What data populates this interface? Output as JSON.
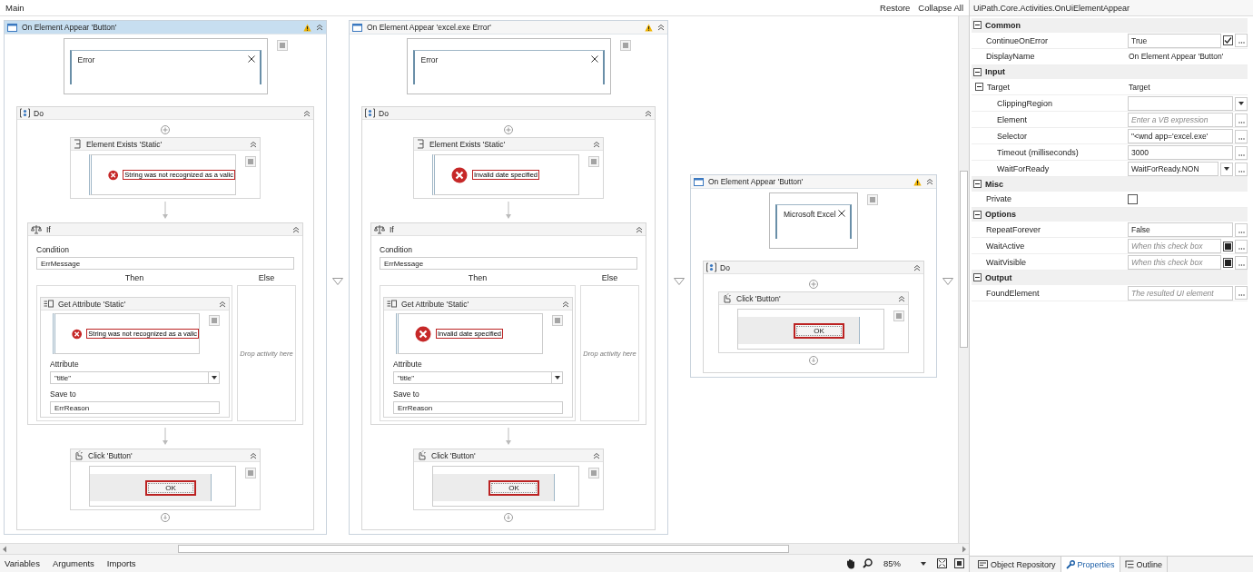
{
  "header": {
    "title": "Main",
    "actions": [
      "Restore",
      "Collapse All"
    ]
  },
  "activities": [
    {
      "title": "On Element Appear 'Button'",
      "selected": true,
      "warning": true,
      "preview": {
        "title": "Error"
      },
      "sequence": {
        "title": "Do",
        "items": [
          {
            "kind": "element_exists",
            "title": "Element Exists 'Static'",
            "preview_text": "String was not recognized as a valic"
          },
          {
            "kind": "if",
            "title": "If",
            "condition_label": "Condition",
            "condition": "ErrMessage",
            "then_label": "Then",
            "else_label": "Else",
            "else_placeholder": "Drop activity here",
            "then": {
              "title": "Get Attribute 'Static'",
              "preview_text": "String was not recognized as a valic",
              "attribute_label": "Attribute",
              "attribute": "\"title\"",
              "save_label": "Save to",
              "save_to": "ErrReason"
            }
          },
          {
            "kind": "click",
            "title": "Click 'Button'",
            "button": "OK"
          }
        ]
      }
    },
    {
      "title": "On Element Appear 'excel.exe  Error'",
      "selected": false,
      "warning": true,
      "preview": {
        "title": "Error"
      },
      "sequence": {
        "title": "Do",
        "items": [
          {
            "kind": "element_exists",
            "title": "Element Exists 'Static'",
            "preview_text": "Invalid date specified"
          },
          {
            "kind": "if",
            "title": "If",
            "condition_label": "Condition",
            "condition": "ErrMessage",
            "then_label": "Then",
            "else_label": "Else",
            "else_placeholder": "Drop activity here",
            "then": {
              "title": "Get Attribute 'Static'",
              "preview_text": "Invalid date specified",
              "attribute_label": "Attribute",
              "attribute": "\"title\"",
              "save_label": "Save to",
              "save_to": "ErrReason"
            }
          },
          {
            "kind": "click",
            "title": "Click 'Button'",
            "button": "OK"
          }
        ]
      }
    },
    {
      "title": "On Element Appear 'Button'",
      "selected": false,
      "warning": true,
      "preview": {
        "title": "Microsoft Excel"
      },
      "sequence": {
        "title": "Do",
        "items": [
          {
            "kind": "click",
            "title": "Click 'Button'",
            "button": "OK"
          }
        ]
      }
    }
  ],
  "bottom_tabs": [
    "Variables",
    "Arguments",
    "Imports"
  ],
  "zoom": "85%",
  "properties": {
    "type": "UiPath.Core.Activities.OnUiElementAppear",
    "categories": [
      {
        "name": "Common",
        "expanded": true,
        "rows": [
          {
            "name": "ContinueOnError",
            "kind": "check_more",
            "value": "True",
            "checked": true
          },
          {
            "name": "DisplayName",
            "kind": "static",
            "value": "On Element Appear 'Button'"
          }
        ]
      },
      {
        "name": "Input",
        "expanded": true,
        "rows": [
          {
            "name": "Target",
            "kind": "static",
            "value": "Target",
            "expanded": true,
            "children": [
              {
                "name": "ClippingRegion",
                "kind": "combo"
              },
              {
                "name": "Element",
                "kind": "text",
                "placeholder": "Enter a VB expression"
              },
              {
                "name": "Selector",
                "kind": "text",
                "value": "\"<wnd app='excel.exe'"
              },
              {
                "name": "Timeout (milliseconds)",
                "kind": "text",
                "value": "3000"
              },
              {
                "name": "WaitForReady",
                "kind": "combo_more",
                "value": "WaitForReady.NON"
              }
            ]
          }
        ]
      },
      {
        "name": "Misc",
        "expanded": true,
        "rows": [
          {
            "name": "Private",
            "kind": "check",
            "checked": false,
            "indeterminate": false
          }
        ]
      },
      {
        "name": "Options",
        "expanded": true,
        "rows": [
          {
            "name": "RepeatForever",
            "kind": "text",
            "value": "False"
          },
          {
            "name": "WaitActive",
            "kind": "check_more",
            "placeholder": "When this check box",
            "checked": false,
            "indeterminate": true
          },
          {
            "name": "WaitVisible",
            "kind": "check_more",
            "placeholder": "When this check box",
            "checked": false,
            "indeterminate": true
          }
        ]
      },
      {
        "name": "Output",
        "expanded": true,
        "rows": [
          {
            "name": "FoundElement",
            "kind": "text",
            "placeholder": "The resulted UI element"
          }
        ]
      }
    ]
  },
  "panel_tabs": [
    {
      "label": "Object Repository",
      "selected": false
    },
    {
      "label": "Properties",
      "selected": true
    },
    {
      "label": "Outline",
      "selected": false
    }
  ]
}
